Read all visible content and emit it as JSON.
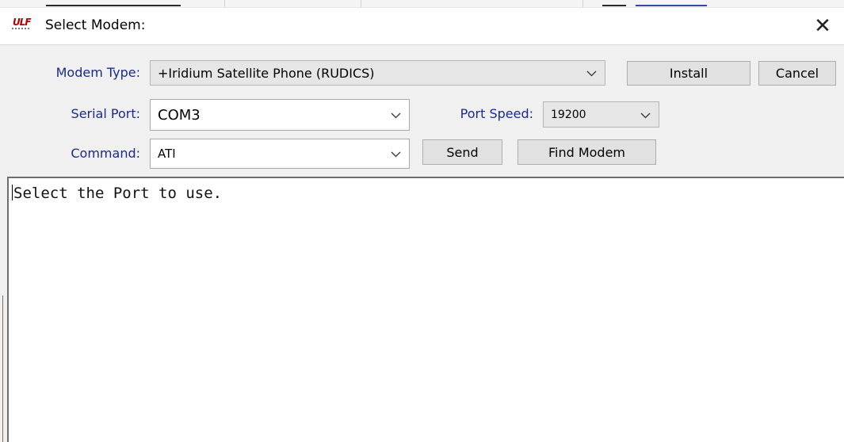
{
  "window": {
    "title": "Select Modem:",
    "close_glyph": "✕"
  },
  "form": {
    "modem_type": {
      "label": "Modem Type:",
      "value": "+Iridium Satellite Phone (RUDICS)"
    },
    "serial_port": {
      "label": "Serial Port:",
      "value": "COM3"
    },
    "port_speed": {
      "label": "Port Speed:",
      "value": "19200"
    },
    "command": {
      "label": "Command:",
      "value": "ATI"
    }
  },
  "buttons": {
    "install": "Install",
    "cancel": "Cancel",
    "send": "Send",
    "find_modem": "Find Modem"
  },
  "output": {
    "text": "Select the Port to use."
  },
  "icons": {
    "app": "modem-app-icon",
    "close": "close-icon",
    "dropdown": "chevron-down-icon"
  },
  "colors": {
    "label": "#1a2a8a",
    "panel": "#f0f0f0",
    "button": "#e1e1e1"
  }
}
